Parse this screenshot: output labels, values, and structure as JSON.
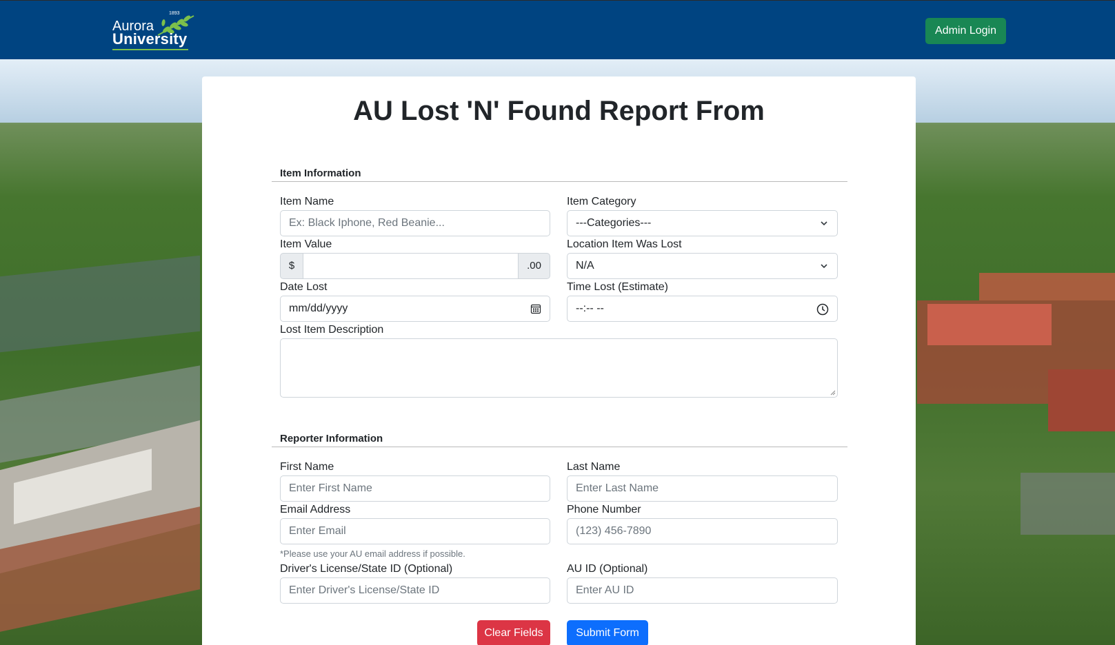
{
  "header": {
    "logo_line1": "Aurora",
    "logo_line2": "University",
    "logo_year": "1893",
    "admin_button": "Admin Login"
  },
  "form": {
    "title": "AU Lost 'N' Found Report From",
    "item_section": {
      "heading": "Item Information",
      "item_name": {
        "label": "Item Name",
        "placeholder": "Ex: Black Iphone, Red Beanie..."
      },
      "item_category": {
        "label": "Item Category",
        "value": "---Categories---"
      },
      "item_value": {
        "label": "Item Value",
        "prefix": "$",
        "suffix": ".00"
      },
      "location": {
        "label": "Location Item Was Lost",
        "value": "N/A"
      },
      "date_lost": {
        "label": "Date Lost",
        "placeholder": "mm/dd/yyyy"
      },
      "time_lost": {
        "label": "Time Lost (Estimate)",
        "placeholder": "--:-- --"
      },
      "description": {
        "label": "Lost Item Description"
      }
    },
    "reporter_section": {
      "heading": "Reporter Information",
      "first_name": {
        "label": "First Name",
        "placeholder": "Enter First Name"
      },
      "last_name": {
        "label": "Last Name",
        "placeholder": "Enter Last Name"
      },
      "email": {
        "label": "Email Address",
        "placeholder": "Enter Email",
        "note": "*Please use your AU email address if possible."
      },
      "phone": {
        "label": "Phone Number",
        "placeholder": "(123) 456-7890"
      },
      "license": {
        "label": "Driver's License/State ID (Optional)",
        "placeholder": "Enter Driver's License/State ID"
      },
      "au_id": {
        "label": "AU ID (Optional)",
        "placeholder": "Enter AU ID"
      }
    },
    "buttons": {
      "clear": "Clear Fields",
      "submit": "Submit Form"
    }
  },
  "colors": {
    "navbar": "#004481",
    "admin_button": "#198754",
    "clear_button": "#dc3545",
    "submit_button": "#0d6efd"
  }
}
